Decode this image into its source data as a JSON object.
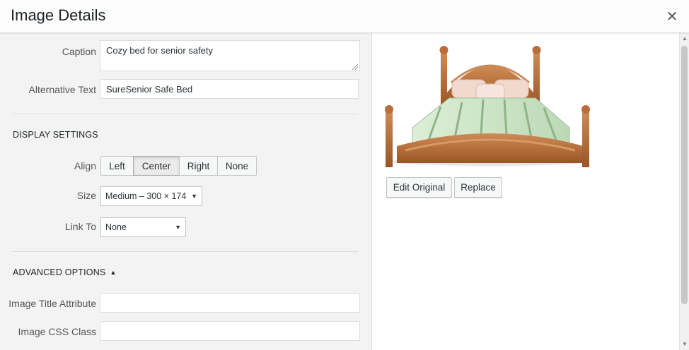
{
  "header": {
    "title": "Image Details",
    "close_icon": "close-icon"
  },
  "form": {
    "caption_label": "Caption",
    "caption_value": "Cozy bed for senior safety",
    "alt_label": "Alternative Text",
    "alt_value": "SureSenior Safe Bed"
  },
  "display_settings": {
    "heading": "DISPLAY SETTINGS",
    "align_label": "Align",
    "align_options": [
      "Left",
      "Center",
      "Right",
      "None"
    ],
    "align_selected": "Center",
    "size_label": "Size",
    "size_value": "Medium – 300 × 174",
    "link_label": "Link To",
    "link_value": "None"
  },
  "advanced": {
    "heading": "ADVANCED OPTIONS",
    "title_attr_label": "Image Title Attribute",
    "title_attr_value": "",
    "css_class_label": "Image CSS Class",
    "css_class_value": ""
  },
  "preview": {
    "image_icon": "bed-image",
    "edit_button": "Edit Original",
    "replace_button": "Replace"
  },
  "colors": {
    "wood": "#b86d3a",
    "sheet": "#cfe6c8",
    "panel_bg": "#f3f3f3"
  }
}
